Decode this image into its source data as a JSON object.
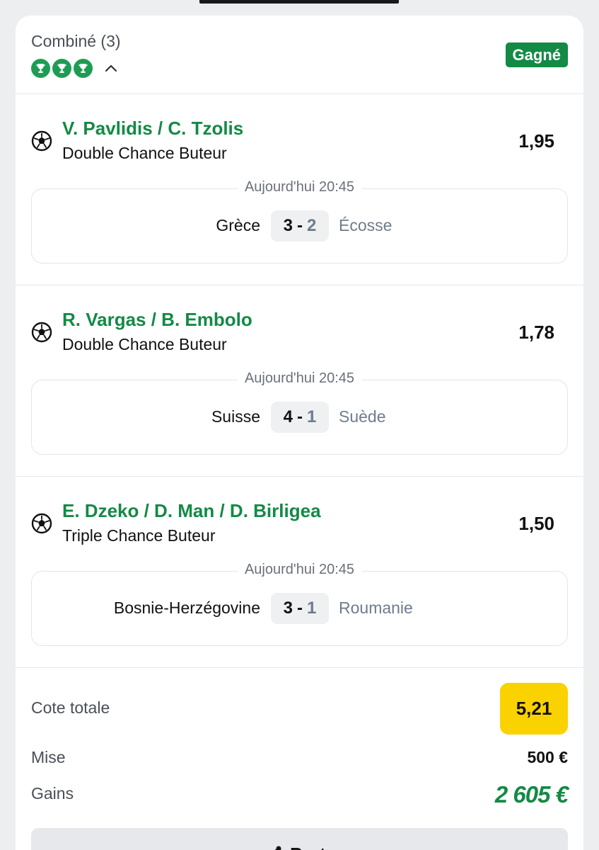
{
  "header": {
    "title": "Combiné (3)",
    "status": "Gagné",
    "trophy_count": 3
  },
  "bets": [
    {
      "players": "V. Pavlidis / C. Tzolis",
      "market": "Double Chance Buteur",
      "odds": "1,95",
      "time": "Aujourd'hui 20:45",
      "home": "Grèce",
      "home_score": "3",
      "separator": "-",
      "away_score": "2",
      "away": "Écosse"
    },
    {
      "players": "R. Vargas / B. Embolo",
      "market": "Double Chance Buteur",
      "odds": "1,78",
      "time": "Aujourd'hui 20:45",
      "home": "Suisse",
      "home_score": "4",
      "separator": "-",
      "away_score": "1",
      "away": "Suède"
    },
    {
      "players": "E. Dzeko / D. Man / D. Birligea",
      "market": "Triple Chance Buteur",
      "odds": "1,50",
      "time": "Aujourd'hui 20:45",
      "home": "Bosnie-Herzégovine",
      "home_score": "3",
      "separator": "-",
      "away_score": "1",
      "away": "Roumanie"
    }
  ],
  "summary": {
    "total_odds_label": "Cote totale",
    "total_odds": "5,21",
    "stake_label": "Mise",
    "stake": "500 €",
    "winnings_label": "Gains",
    "winnings": "2 605 €"
  },
  "share": {
    "label": "Partager"
  },
  "colors": {
    "brand_green": "#138a45",
    "trophy_green": "#1d9d54",
    "odds_yellow": "#fad200"
  },
  "icons": {
    "trophy": "trophy-icon",
    "chevron": "chevron-up-icon",
    "ball": "soccer-ball-icon",
    "share": "share-icon"
  }
}
